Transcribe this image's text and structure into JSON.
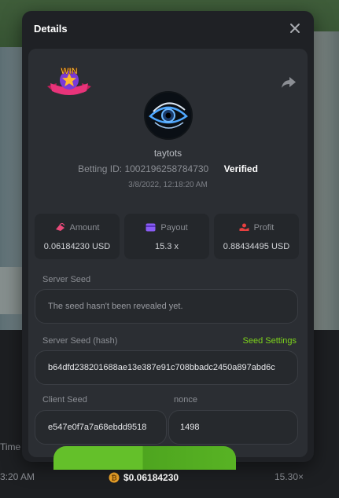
{
  "background": {
    "col_header": "Time",
    "row_time": "3:20 AM",
    "row_amount": "$0.06184230",
    "row_multiplier": "15.30×"
  },
  "modal": {
    "title": "Details",
    "badge_text": "WIN",
    "username": "taytots",
    "betting_id_label": "Betting ID:",
    "betting_id": "1002196258784730",
    "verified_label": "Verified",
    "timestamp": "3/8/2022, 12:18:20 AM",
    "stats": {
      "amount": {
        "label": "Amount",
        "value": "0.06184230 USD"
      },
      "payout": {
        "label": "Payout",
        "value": "15.3 x"
      },
      "profit": {
        "label": "Profit",
        "value": "0.88434495 USD"
      }
    },
    "server_seed": {
      "label": "Server Seed",
      "value": "The seed hasn't been revealed yet."
    },
    "server_seed_hash": {
      "label": "Server Seed (hash)",
      "link": "Seed Settings",
      "value": "b64dfd238201688ae13e387e91c708bbadc2450a897abd6c"
    },
    "client_seed": {
      "label": "Client Seed",
      "value": "e547e0f7a7a68ebdd9518"
    },
    "nonce": {
      "label": "nonce",
      "value": "1498"
    }
  },
  "colors": {
    "accent_green": "#7dd31c",
    "amount_icon": "#e84a7a",
    "payout_icon": "#8a5cf5",
    "profit_icon": "#e84040"
  }
}
